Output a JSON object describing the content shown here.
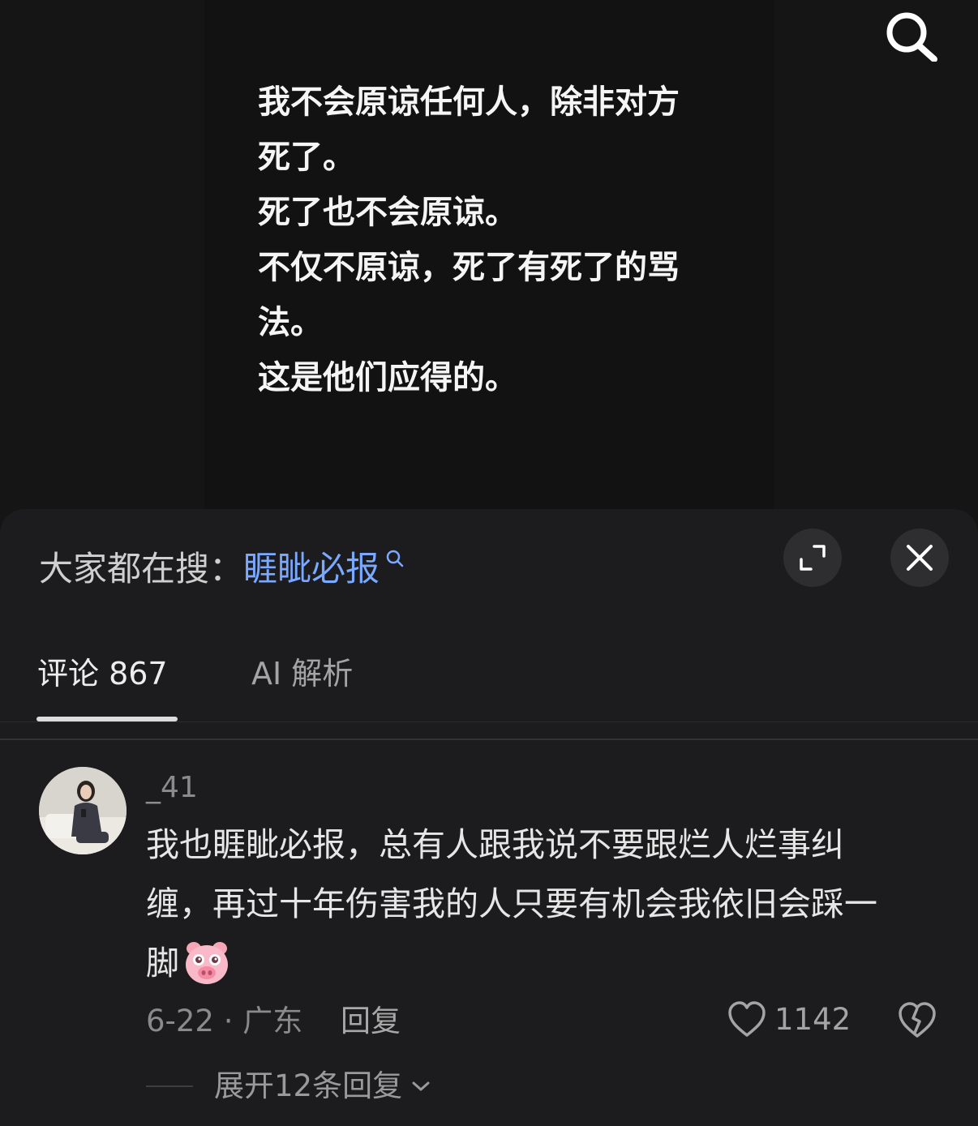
{
  "video": {
    "lines": [
      "我不会原谅任何人，除非对方",
      "死了。",
      "死了也不会原谅。",
      "不仅不原谅，死了有死了的骂",
      "法。",
      "这是他们应得的。"
    ]
  },
  "panel": {
    "trending_label": "大家都在搜：",
    "trending_query": "睚眦必报",
    "tabs": {
      "comments": "评论 867",
      "ai": "AI 解析"
    }
  },
  "comment": {
    "username": "_41",
    "lines": [
      "我也睚眦必报，总有人跟我说不要跟烂人烂事纠",
      "缠，再过十年伤害我的人只要有机会我依旧会踩一",
      "脚"
    ],
    "date_location": "6-22 · 广东",
    "reply_label": "回复",
    "like_count": "1142",
    "expand_replies_label": "展开12条回复"
  },
  "colors": {
    "background": "#000000",
    "panel": "#1c1c1e",
    "link": "#7aa9ff"
  }
}
